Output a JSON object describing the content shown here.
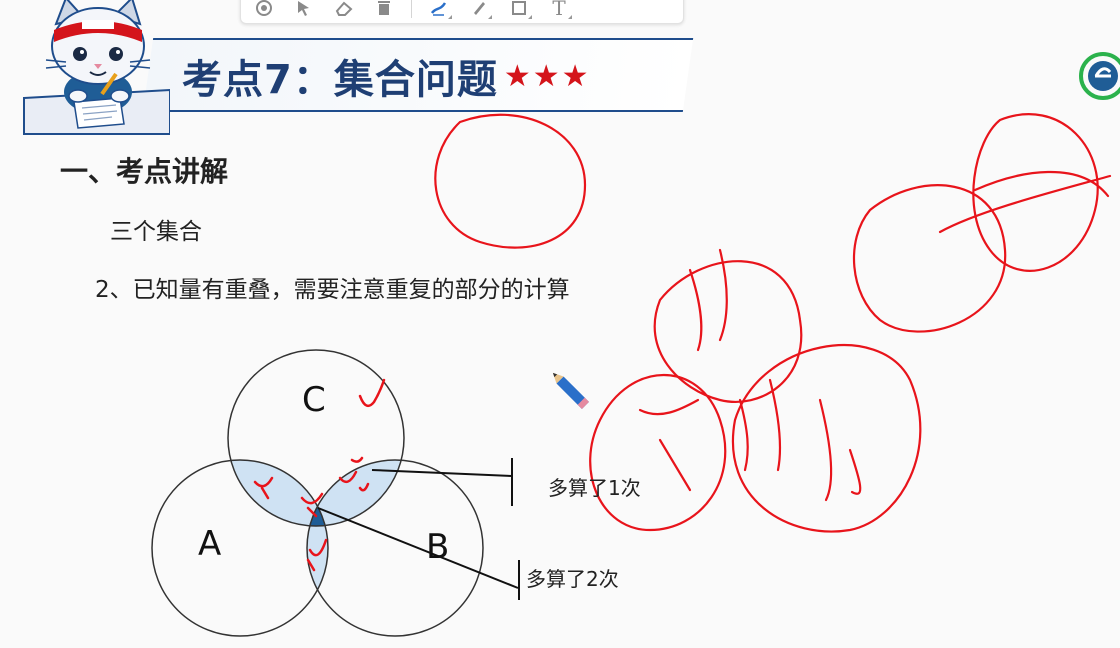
{
  "title": {
    "text": "考点7：集合问题",
    "stars": "★★★"
  },
  "section": {
    "heading": "一、考点讲解",
    "subheading": "三个集合",
    "point": "2、已知量有重叠，需要注意重复的部分的计算"
  },
  "venn": {
    "label_c": "C",
    "label_a": "A",
    "label_b": "B",
    "note_once": "多算了1次",
    "note_twice": "多算了2次"
  },
  "toolbar": {
    "items": [
      "record-icon",
      "pointer-icon",
      "eraser-icon",
      "trash-icon",
      "pen-icon",
      "marker-icon",
      "rectangle-icon",
      "text-icon"
    ],
    "text_tool": "T"
  },
  "colors": {
    "title": "#1f3f74",
    "stars": "#d4141b",
    "banner_border": "#1f4d8c",
    "ink": "#e8141b",
    "pair_overlap": "#cfe2f3",
    "triple_overlap": "#1f5d96"
  }
}
